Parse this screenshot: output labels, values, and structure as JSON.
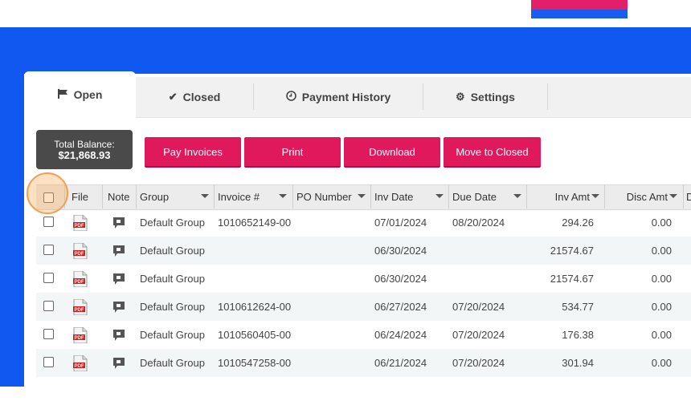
{
  "tabs": [
    {
      "label": "Open",
      "icon": "flag-icon"
    },
    {
      "label": "Closed",
      "icon": "check-icon"
    },
    {
      "label": "Payment History",
      "icon": "clock-icon"
    },
    {
      "label": "Settings",
      "icon": "gear-icon"
    }
  ],
  "balance": {
    "label": "Total Balance:",
    "amount": "$21,868.93"
  },
  "buttons": {
    "pay": "Pay Invoices",
    "print": "Print",
    "download": "Download",
    "move": "Move to Closed"
  },
  "columns": {
    "file": "File",
    "note": "Note",
    "group": "Group",
    "invoice": "Invoice #",
    "po": "PO Number",
    "inv_date": "Inv Date",
    "due_date": "Due Date",
    "inv_amt": "Inv Amt",
    "disc_amt": "Disc Amt",
    "more": "D"
  },
  "rows": [
    {
      "group": "Default Group",
      "invoice": "1010652149-00",
      "po": "",
      "inv_date": "07/01/2024",
      "due_date": "08/20/2024",
      "inv_amt": "294.26",
      "disc_amt": "0.00"
    },
    {
      "group": "Default Group",
      "invoice": "",
      "po": "",
      "inv_date": "06/30/2024",
      "due_date": "",
      "inv_amt": "21574.67",
      "disc_amt": "0.00"
    },
    {
      "group": "Default Group",
      "invoice": "",
      "po": "",
      "inv_date": "06/30/2024",
      "due_date": "",
      "inv_amt": "21574.67",
      "disc_amt": "0.00"
    },
    {
      "group": "Default Group",
      "invoice": "1010612624-00",
      "po": "",
      "inv_date": "06/27/2024",
      "due_date": "07/20/2024",
      "inv_amt": "534.77",
      "disc_amt": "0.00"
    },
    {
      "group": "Default Group",
      "invoice": "1010560405-00",
      "po": "",
      "inv_date": "06/24/2024",
      "due_date": "07/20/2024",
      "inv_amt": "176.38",
      "disc_amt": "0.00"
    },
    {
      "group": "Default Group",
      "invoice": "1010547258-00",
      "po": "",
      "inv_date": "06/21/2024",
      "due_date": "07/20/2024",
      "inv_amt": "301.94",
      "disc_amt": "0.00"
    }
  ],
  "colors": {
    "accent": "#e0185c",
    "background": "#1158f0",
    "balance_bg": "#4a4a4a"
  }
}
